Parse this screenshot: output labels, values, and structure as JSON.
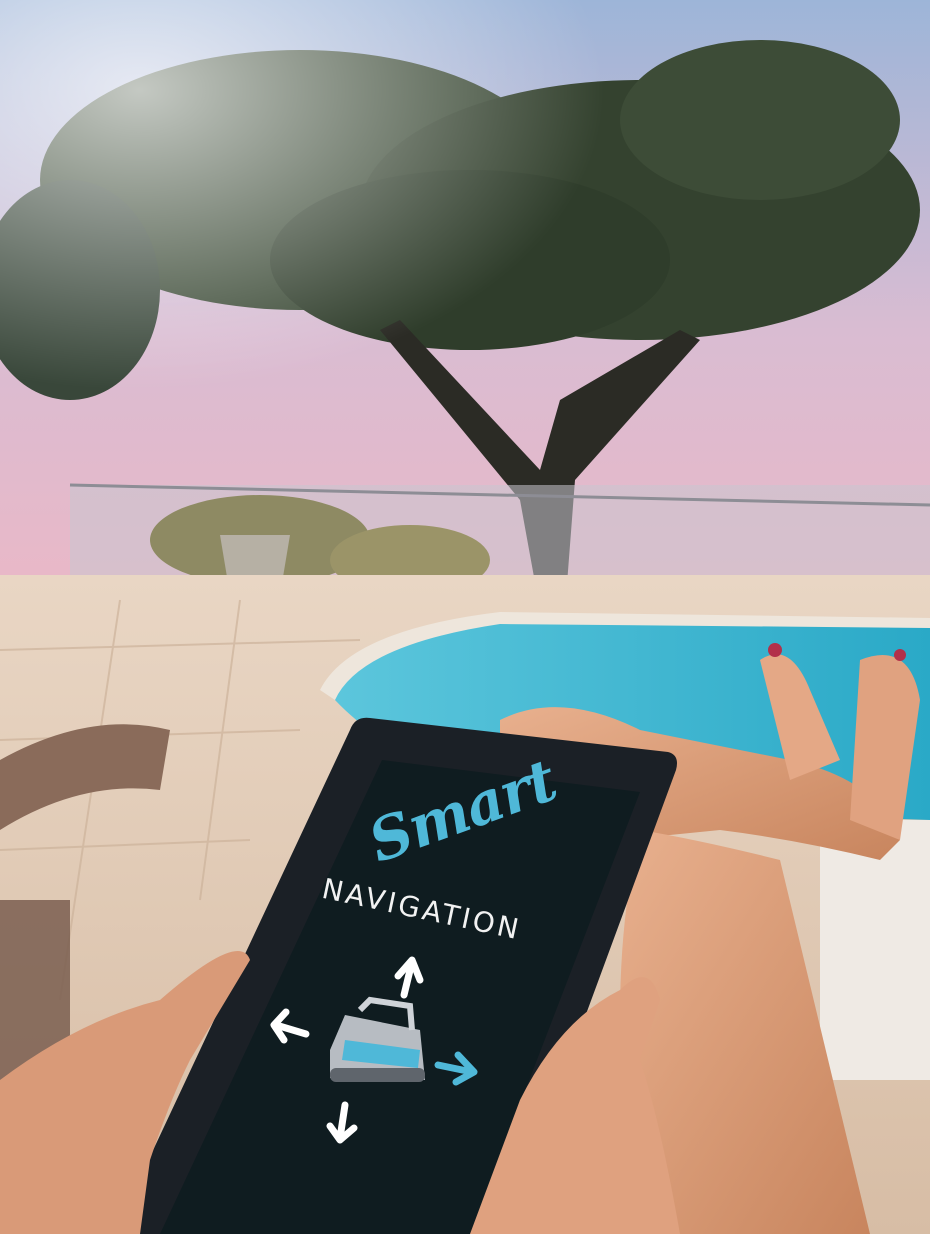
{
  "screen": {
    "brand_script": "Smart",
    "brand_caps": "NAVIGATION"
  },
  "colors": {
    "sky_top": "#9fb6d6",
    "sky_pink": "#e8b8c8",
    "pool": "#3cb6d0",
    "tablet_frame": "#1a1f25",
    "tablet_screen": "#0e1b1f",
    "accent": "#4fb8d8",
    "arrow_white": "#ffffff"
  },
  "icons": [
    "arrow-up-icon",
    "arrow-left-icon",
    "arrow-right-icon",
    "arrow-down-icon",
    "pool-robot-icon"
  ]
}
